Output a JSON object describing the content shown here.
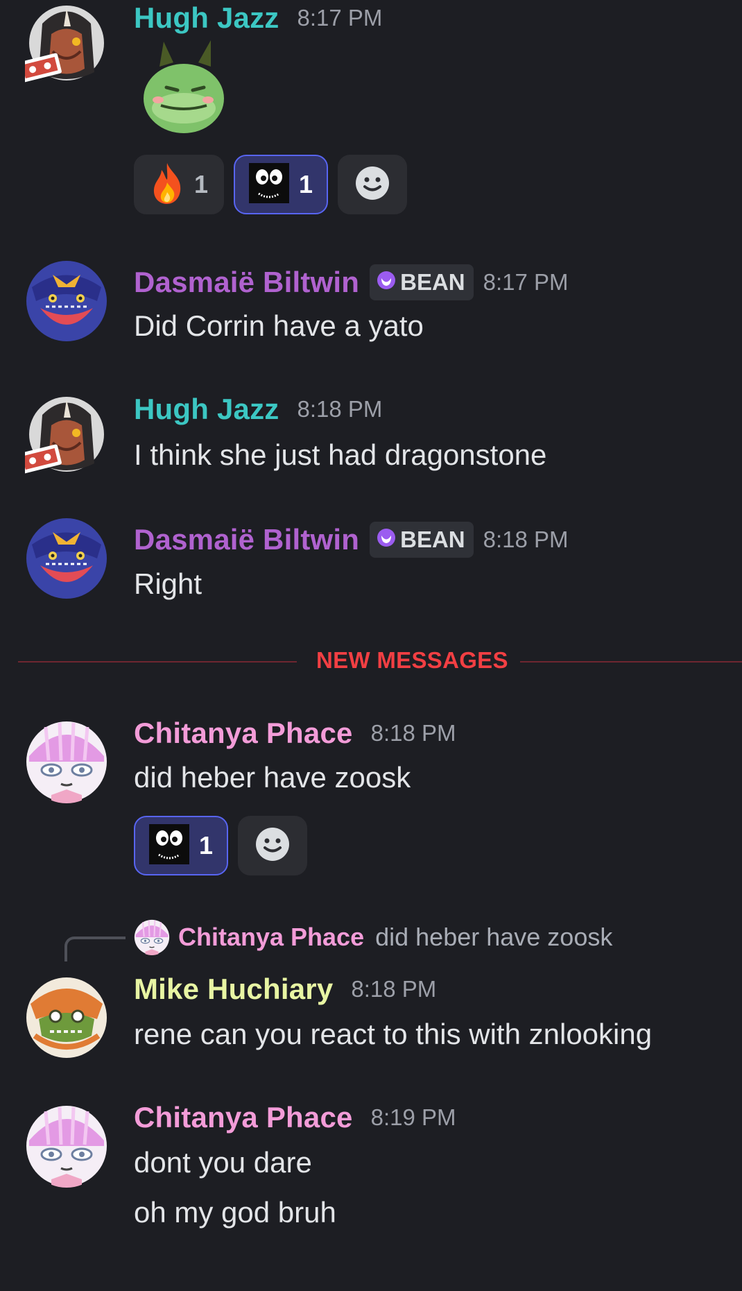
{
  "colors": {
    "background": "#1d1e23",
    "hugh_name": "#3cc7c3",
    "dasmaie_name": "#b062cf",
    "chitanya_name": "#f39cd8",
    "mike_name": "#e8f5a3",
    "new_messages": "#f23f43",
    "reaction_active_border": "#5865f2"
  },
  "messages": [
    {
      "author": "Hugh Jazz",
      "time": "8:17 PM",
      "sticker": "green-dragon-sticker",
      "reactions": [
        {
          "icon": "fire-emoji",
          "count": "1",
          "active": false
        },
        {
          "icon": "eyes-creature-emoji",
          "count": "1",
          "active": true
        }
      ]
    },
    {
      "author": "Dasmaië Biltwin",
      "tag": "BEAN",
      "time": "8:17 PM",
      "text": "Did Corrin have a yato"
    },
    {
      "author": "Hugh Jazz",
      "time": "8:18 PM",
      "text": "I think she just had dragonstone"
    },
    {
      "author": "Dasmaië Biltwin",
      "tag": "BEAN",
      "time": "8:18 PM",
      "text": "Right"
    },
    {
      "author": "Chitanya Phace",
      "time": "8:18 PM",
      "text": "did heber have zoosk",
      "reactions": [
        {
          "icon": "eyes-creature-emoji",
          "count": "1",
          "active": true
        }
      ]
    },
    {
      "reply_to": {
        "author": "Chitanya Phace",
        "text": "did heber have zoosk"
      },
      "author": "Mike Huchiary",
      "time": "8:18 PM",
      "text": "rene can you react to this with znlooking"
    },
    {
      "author": "Chitanya Phace",
      "time": "8:19 PM",
      "lines": [
        "dont you dare",
        "oh my god bruh"
      ]
    }
  ],
  "divider": {
    "label": "NEW MESSAGES"
  }
}
